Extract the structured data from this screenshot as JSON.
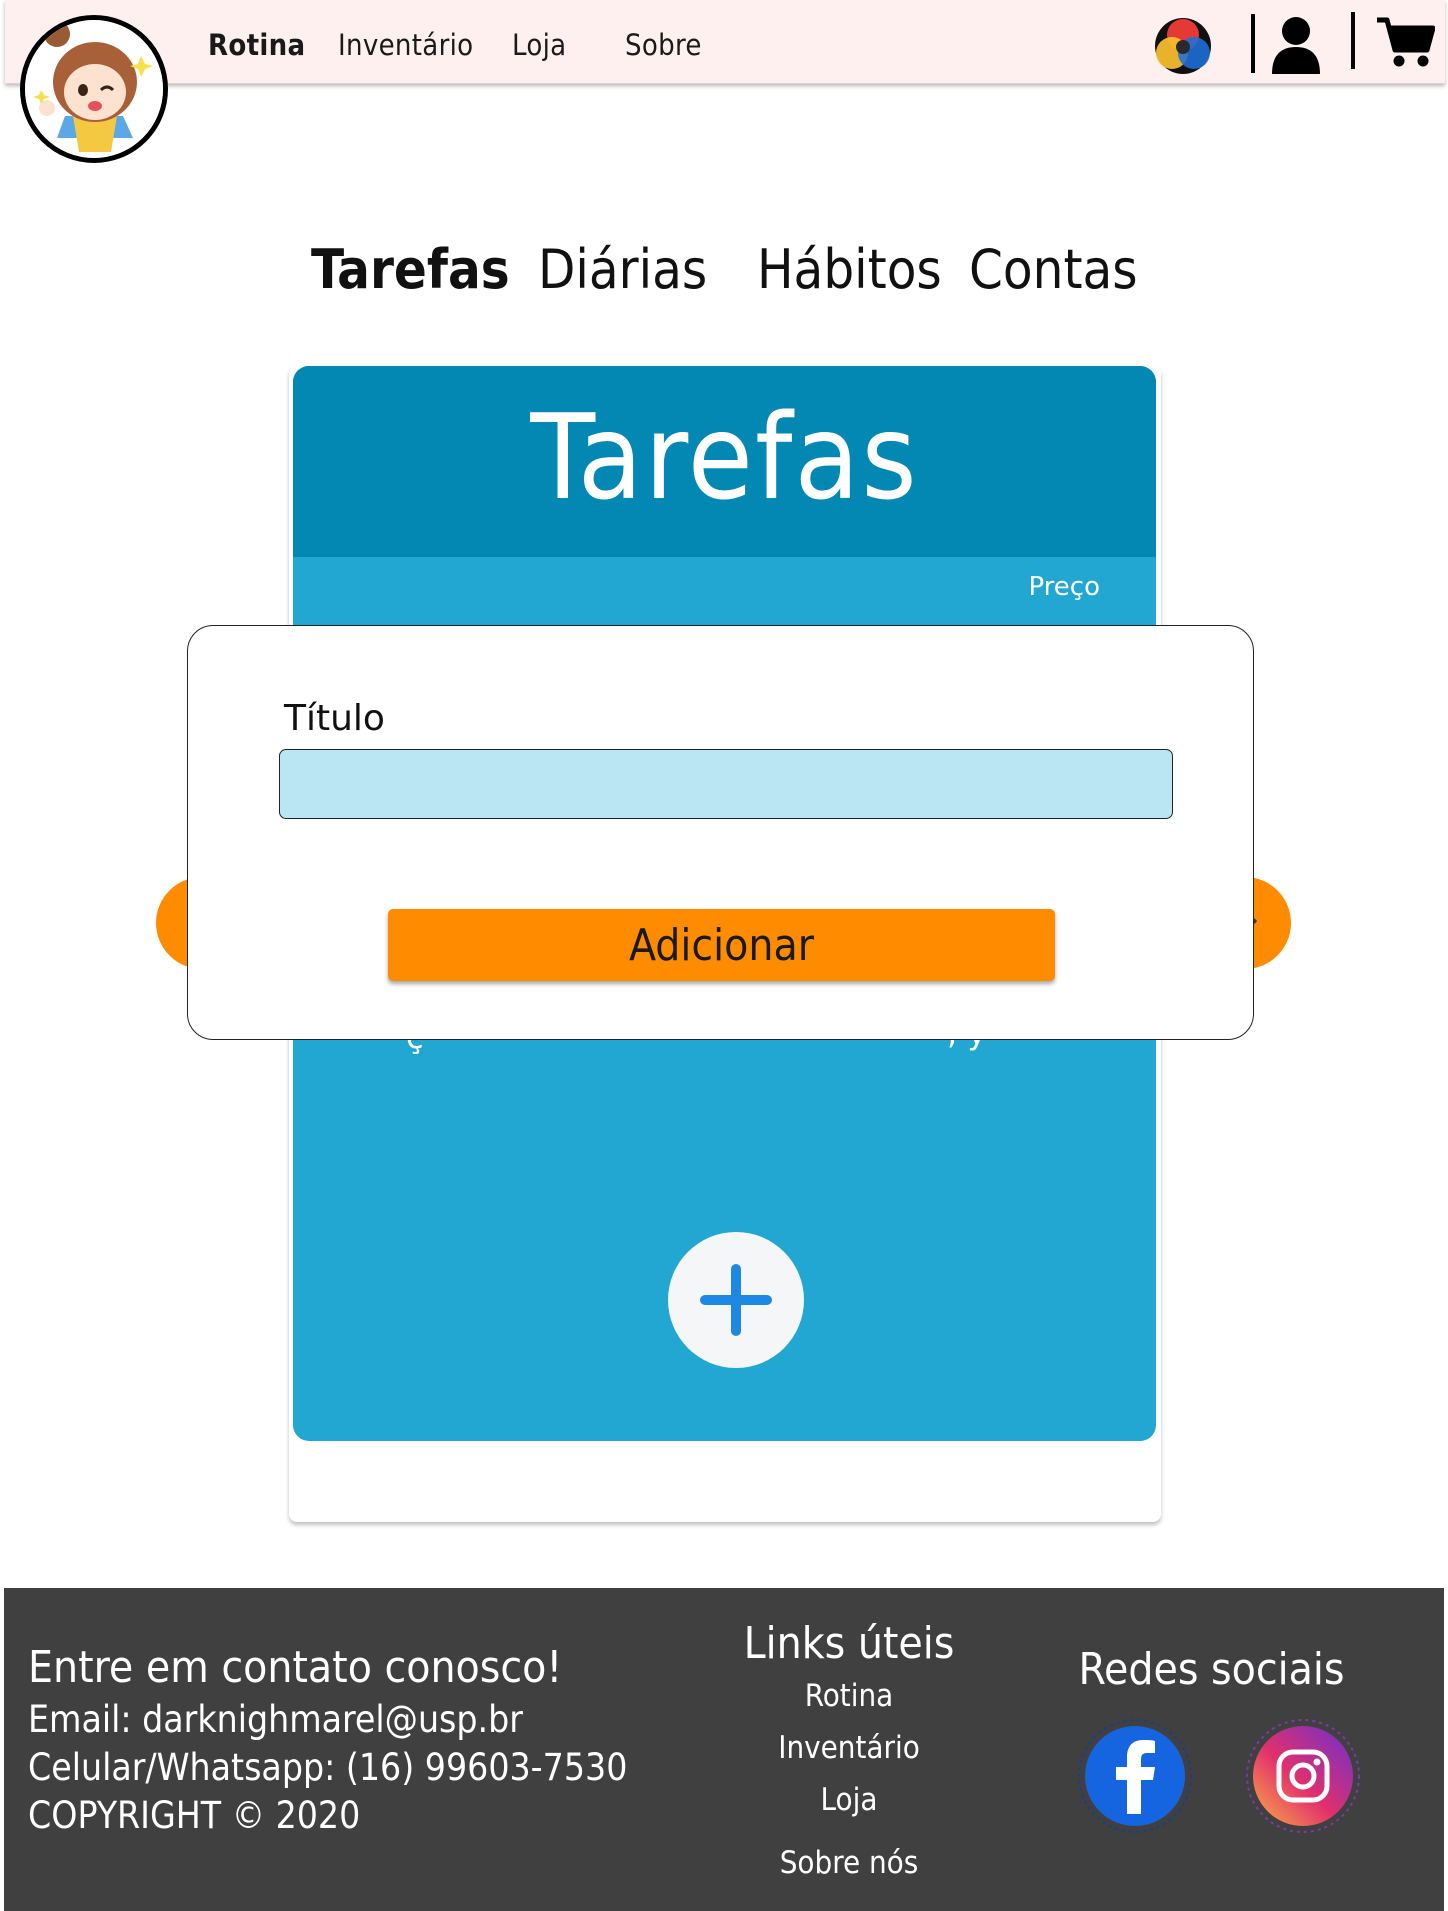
{
  "header": {
    "nav": [
      "Rotina",
      "Inventário",
      "Loja",
      "Sobre"
    ]
  },
  "tabs": [
    "Tarefas",
    "Diárias",
    "Hábitos",
    "Contas"
  ],
  "panel": {
    "title": "Tarefas",
    "column_price": "Preço"
  },
  "modal": {
    "field_label": "Título",
    "field_value": "",
    "submit_label": "Adicionar"
  },
  "footer": {
    "contact_title": "Entre em contato conosco!",
    "email": "Email: darknighmarel@usp.br",
    "phone": "Celular/Whatsapp: (16) 99603-7530",
    "copyright": "COPYRIGHT © 2020",
    "links_title": "Links úteis",
    "links": [
      "Rotina",
      "Inventário",
      "Loja",
      "Sobre nós"
    ],
    "social_title": "Redes sociais"
  },
  "colors": {
    "header_bg": "#fdf0ef",
    "panel_header": "#0288b3",
    "panel_body": "#21a7d1",
    "accent_orange": "#ff8c00",
    "input_bg": "#b9e6f2",
    "footer_bg": "#404040"
  },
  "icons": [
    "palette-icon",
    "user-icon",
    "cart-icon",
    "plus-icon",
    "facebook-icon",
    "instagram-icon"
  ]
}
